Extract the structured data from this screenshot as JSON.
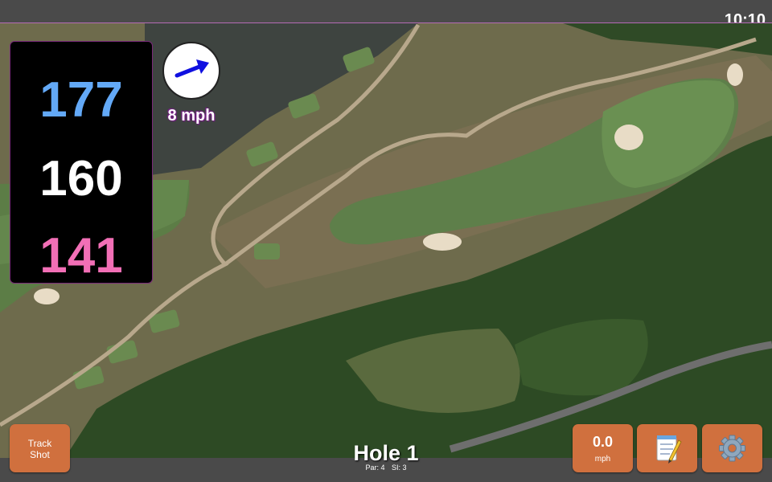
{
  "status": {
    "time": "10:10"
  },
  "distances": {
    "back": "177",
    "middle": "160",
    "front": "141"
  },
  "wind": {
    "speed_label": "8 mph",
    "direction": "arrow pointing east-north-east"
  },
  "buttons": {
    "track_shot": {
      "line1": "Track",
      "line2": "Shot"
    },
    "speed": {
      "value": "0.0",
      "unit": "mph"
    },
    "notes_icon": "notepad-icon",
    "settings_icon": "gear-icon"
  },
  "hole": {
    "title": "Hole 1",
    "par": "Par: 4",
    "si": "SI: 3"
  },
  "colors": {
    "back_distance": "#63a9f7",
    "middle_distance": "#ffffff",
    "front_distance": "#f26fb6",
    "button": "#d0703e",
    "wind_arrow": "#1010e0"
  }
}
